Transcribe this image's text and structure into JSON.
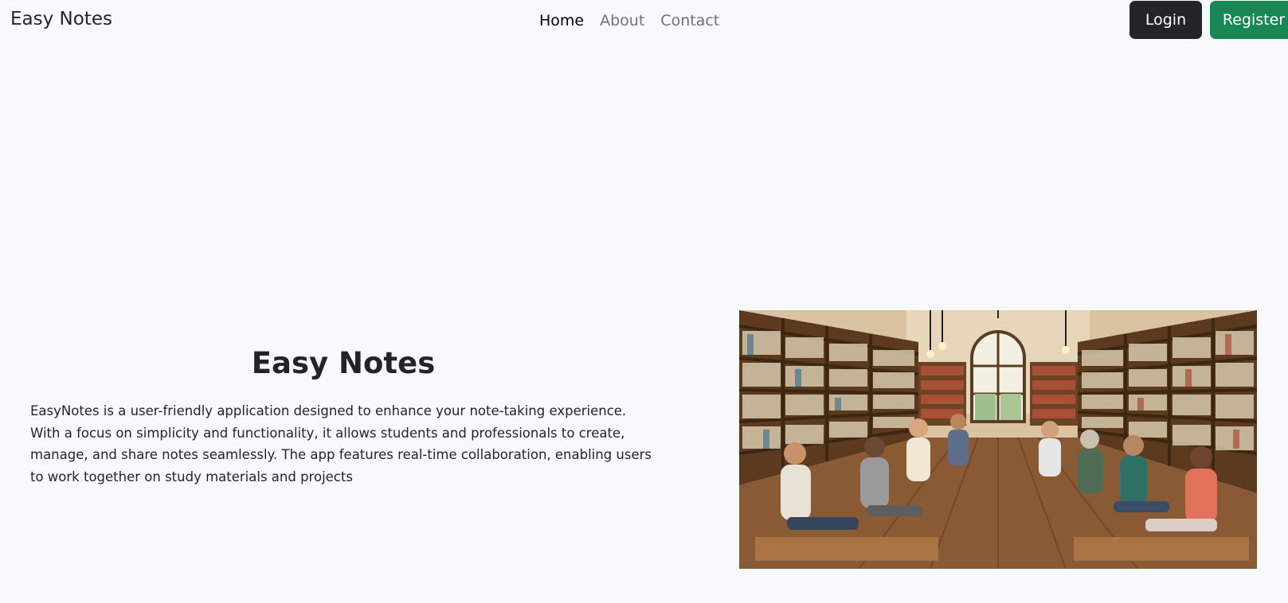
{
  "navbar": {
    "brand": "Easy Notes",
    "links": [
      {
        "label": "Home",
        "active": true
      },
      {
        "label": "About",
        "active": false
      },
      {
        "label": "Contact",
        "active": false
      }
    ],
    "login_label": "Login",
    "register_label": "Register"
  },
  "hero": {
    "title": "Easy Notes",
    "description": "EasyNotes is a user-friendly application designed to enhance your note-taking experience. With a focus on simplicity and functionality, it allows students and professionals to create, manage, and share notes seamlessly. The app features real-time collaboration, enabling users to work together on study materials and projects",
    "image_subject": "library-reading-room-illustration"
  },
  "colors": {
    "background": "#f8f9fa",
    "login_button": "#212529",
    "register_button": "#198754",
    "text": "#212529"
  }
}
